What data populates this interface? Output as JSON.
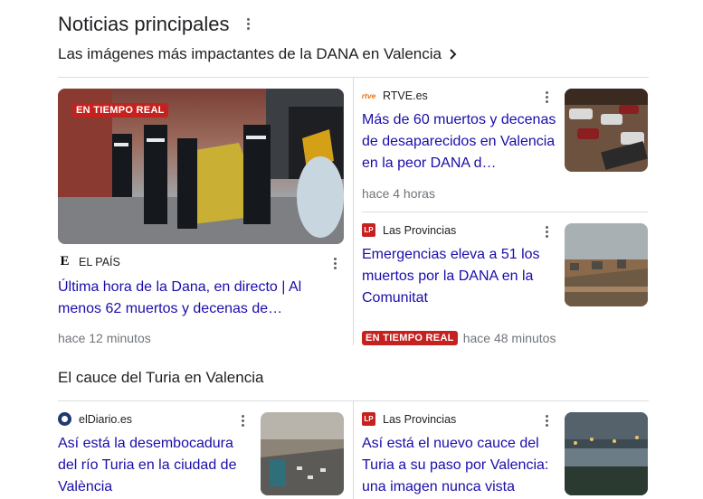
{
  "header": {
    "title": "Noticias principales",
    "subtitle": "Las imágenes más impactantes de la DANA en Valencia"
  },
  "top": {
    "featured": {
      "badge": "EN TIEMPO REAL",
      "source": "EL PAÍS",
      "headline": "Última hora de la Dana, en directo | Al menos 62 muertos y decenas de…",
      "time": "hace 12 minutos"
    },
    "right1": {
      "source": "RTVE.es",
      "logo": "rtve",
      "headline": "Más de 60 muertos y decenas de desaparecidos en Valencia en la peor DANA d…",
      "time": "hace 4 horas"
    },
    "right2": {
      "source": "Las Provincias",
      "logo": "LP",
      "headline": "Emergencias eleva a 51 los muertos por la DANA en la Comunitat",
      "badge": "EN TIEMPO REAL",
      "time": "hace 48 minutos"
    }
  },
  "section2": {
    "title": "El cauce del Turia en Valencia",
    "left": {
      "source": "elDiario.es",
      "headline": "Así está la desembocadura del río Turia en la ciudad de València"
    },
    "right": {
      "source": "Las Provincias",
      "logo": "LP",
      "headline": "Así está el nuevo cauce del Turia a su paso por Valencia: una imagen nunca vista"
    }
  },
  "icons": {
    "more": "more-vert-icon",
    "chevron": "chevron-right-icon",
    "elpais": "el-pais-logo",
    "rtve": "rtve-logo",
    "lp": "las-provincias-logo",
    "eldiario": "eldiario-logo"
  },
  "colors": {
    "link": "#1a0dab",
    "badge": "#c5221f",
    "muted": "#70757a",
    "divider": "#dadce0"
  }
}
